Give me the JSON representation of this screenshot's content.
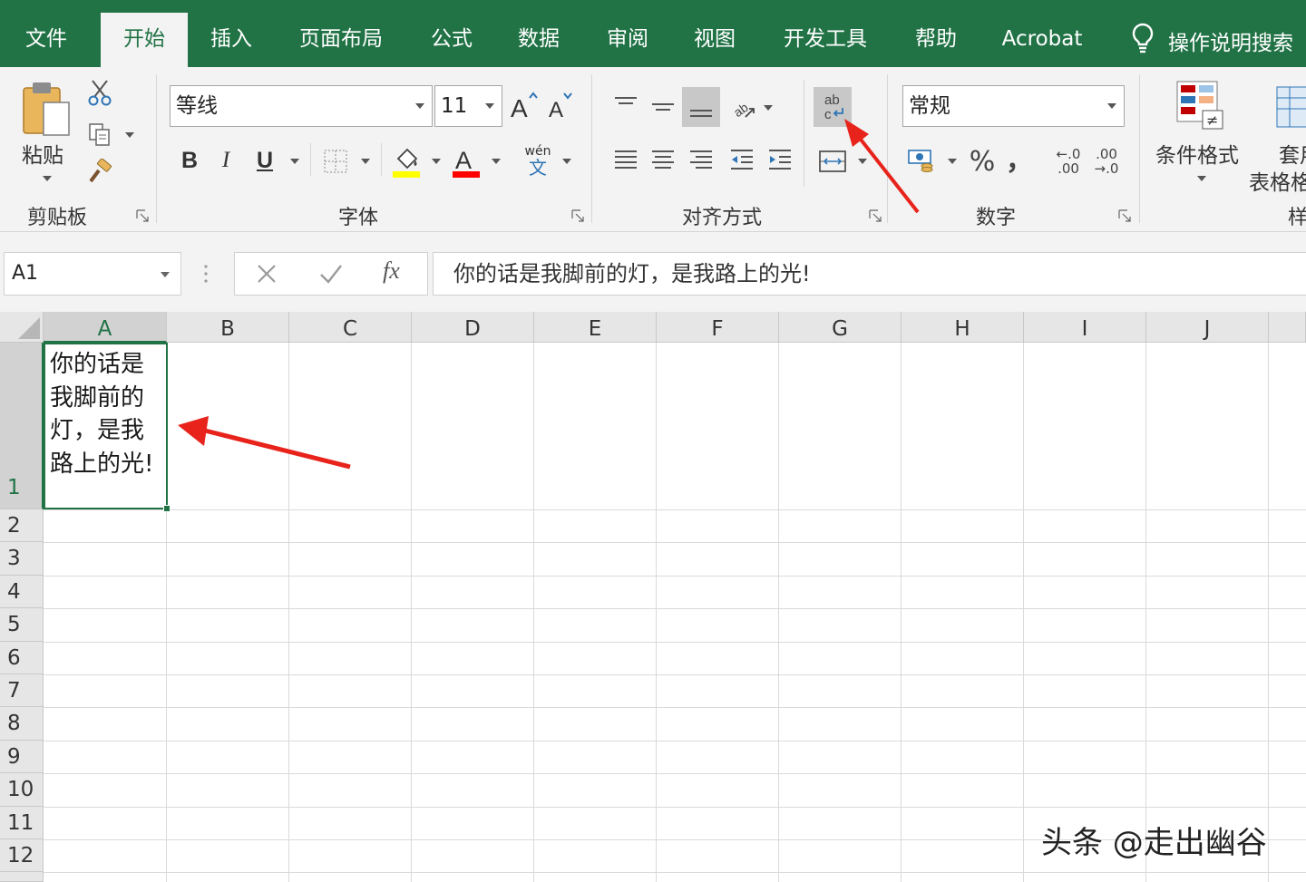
{
  "tabs": [
    {
      "label": "文件",
      "active": false
    },
    {
      "label": "开始",
      "active": true
    },
    {
      "label": "插入",
      "active": false
    },
    {
      "label": "页面布局",
      "active": false
    },
    {
      "label": "公式",
      "active": false
    },
    {
      "label": "数据",
      "active": false
    },
    {
      "label": "审阅",
      "active": false
    },
    {
      "label": "视图",
      "active": false
    },
    {
      "label": "开发工具",
      "active": false
    },
    {
      "label": "帮助",
      "active": false
    },
    {
      "label": "Acrobat",
      "active": false
    }
  ],
  "tell_me": {
    "label": "操作说明搜索",
    "icon": "lightbulb-icon"
  },
  "ribbon": {
    "clipboard": {
      "group_label": "剪贴板",
      "paste_label": "粘贴"
    },
    "font": {
      "group_label": "字体",
      "font_name": "等线",
      "font_size": "11",
      "bold": "B",
      "italic": "I",
      "underline": "U",
      "phonetic_top": "wén",
      "phonetic_bottom": "文",
      "fill_color": "#ffff00",
      "font_color": "#ff0000"
    },
    "alignment": {
      "group_label": "对齐方式",
      "wrap_text_active": true
    },
    "number": {
      "group_label": "数字",
      "format": "常规",
      "percent": "%",
      "comma": "，",
      "inc_decimal_top": "←.0",
      "inc_decimal_bottom": ".00",
      "dec_decimal_top": ".00",
      "dec_decimal_bottom": "→.0"
    },
    "styles": {
      "conditional_format_label": "条件格式",
      "table_format_label_1": "套用",
      "table_format_label_2": "表格格",
      "group_label": "样"
    }
  },
  "formula_bar": {
    "name_box": "A1",
    "fx_label": "fx",
    "content": "你的话是我脚前的灯，是我路上的光!"
  },
  "sheet": {
    "columns": [
      "A",
      "B",
      "C",
      "D",
      "E",
      "F",
      "G",
      "H",
      "I",
      "J"
    ],
    "rows": [
      "1",
      "2",
      "3",
      "4",
      "5",
      "6",
      "7",
      "8",
      "9",
      "10",
      "11",
      "12"
    ],
    "selected_cell": "A1",
    "a1_value": "你的话是我脚前的灯，是我路上的光!"
  },
  "watermark": "头条 @走出幽谷",
  "colors": {
    "accent": "#217346",
    "arrow": "#e8231b"
  }
}
